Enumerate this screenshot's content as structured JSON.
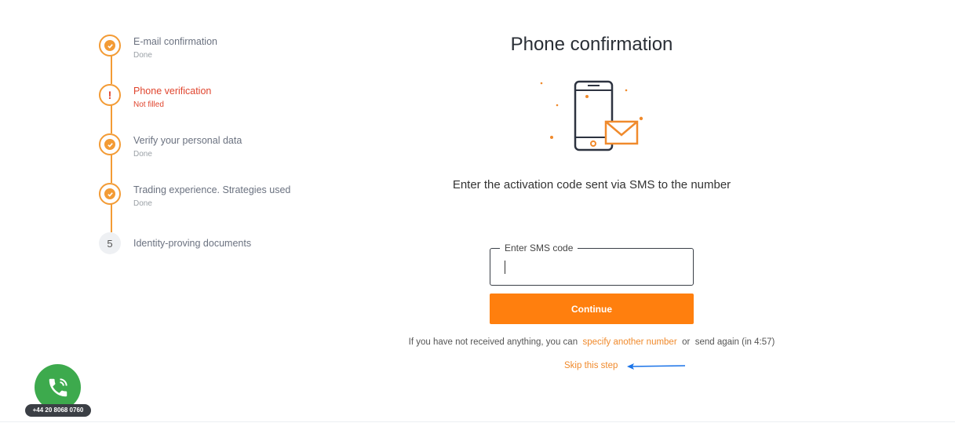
{
  "steps": [
    {
      "title": "E-mail confirmation",
      "status": "Done"
    },
    {
      "title": "Phone verification",
      "status": "Not filled"
    },
    {
      "title": "Verify your personal data",
      "status": "Done"
    },
    {
      "title": "Trading experience. Strategies used",
      "status": "Done"
    },
    {
      "title": "Identity-proving documents",
      "number": "5"
    }
  ],
  "main": {
    "heading": "Phone confirmation",
    "instruction": "Enter the activation code sent via SMS to the number",
    "sms_field": {
      "label": "Enter SMS code",
      "value": ""
    },
    "continue_label": "Continue",
    "note_prefix": "If you have not received anything, you can",
    "specify_link": "specify another number",
    "note_or": "or",
    "send_again": "send again (in 4:57)",
    "skip_label": "Skip this step"
  },
  "call_widget": {
    "phone": "+44 20 8068 0760"
  },
  "colors": {
    "accent": "#ff7f0e",
    "error": "#e0452e",
    "call_green": "#3daa4d",
    "annotation_arrow": "#1a73e8"
  }
}
